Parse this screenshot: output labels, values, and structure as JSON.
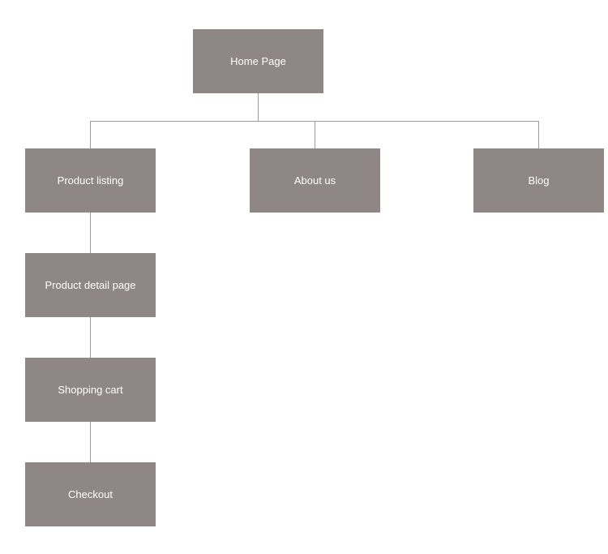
{
  "chart_data": {
    "type": "tree",
    "nodes": [
      {
        "id": "home",
        "label": "Home Page",
        "parent": null
      },
      {
        "id": "product-listing",
        "label": "Product listing",
        "parent": "home"
      },
      {
        "id": "about-us",
        "label": "About us",
        "parent": "home"
      },
      {
        "id": "blog",
        "label": "Blog",
        "parent": "home"
      },
      {
        "id": "product-detail",
        "label": "Product detail page",
        "parent": "product-listing"
      },
      {
        "id": "shopping-cart",
        "label": "Shopping cart",
        "parent": "product-detail"
      },
      {
        "id": "checkout",
        "label": "Checkout",
        "parent": "shopping-cart"
      }
    ]
  },
  "nodes": {
    "home": {
      "label": "Home Page"
    },
    "product_listing": {
      "label": "Product listing"
    },
    "about_us": {
      "label": "About us"
    },
    "blog": {
      "label": "Blog"
    },
    "product_detail": {
      "label": "Product detail page"
    },
    "shopping_cart": {
      "label": "Shopping cart"
    },
    "checkout": {
      "label": "Checkout"
    }
  },
  "colors": {
    "node_bg": "#8f8786",
    "node_text": "#ffffff",
    "connector": "#9b9b9b"
  }
}
